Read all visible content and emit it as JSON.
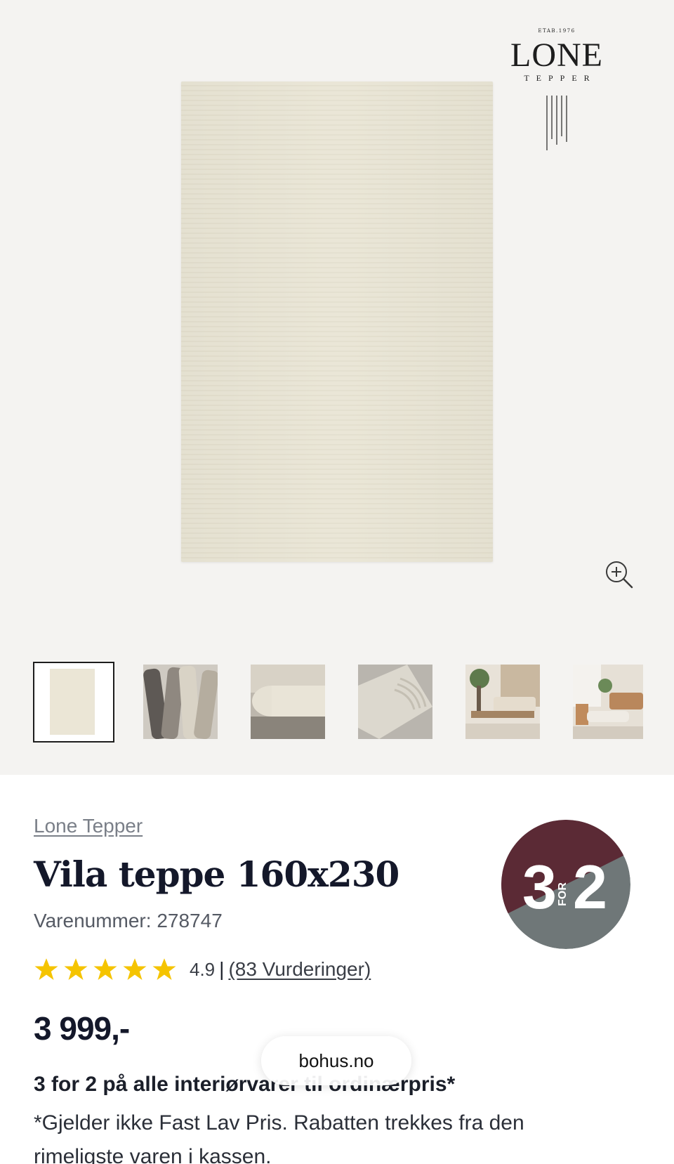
{
  "gallery": {
    "main_image_alt": "Vila teppe",
    "brand_logo": {
      "etab": "ETAB.1976",
      "name": "LONE",
      "sub": "TEPPER"
    },
    "zoom_icon": "zoom-in-icon",
    "thumbnails": [
      {
        "label": "thumbnail-1",
        "active": true
      },
      {
        "label": "thumbnail-2",
        "active": false
      },
      {
        "label": "thumbnail-3",
        "active": false
      },
      {
        "label": "thumbnail-4",
        "active": false
      },
      {
        "label": "thumbnail-5",
        "active": false
      },
      {
        "label": "thumbnail-6",
        "active": false
      }
    ]
  },
  "product": {
    "brand": "Lone Tepper",
    "title": "Vila teppe 160x230",
    "sku_label": "Varenummer:",
    "sku": "278747",
    "rating": {
      "stars": 5,
      "value": "4.9",
      "separator": "|",
      "count_label": "(83 Vurderinger)"
    },
    "price": "3 999,-",
    "badge": {
      "left": "3",
      "middle": "FOR",
      "right": "2",
      "top_color": "#5b2a35",
      "bottom_color": "#6f7778"
    },
    "promo_title": "3 for 2 på alle interiørvarer til ordinærpris*",
    "promo_text": "*Gjelder ikke Fast Lav Pris. Rabatten trekkes fra den rimeligste varen i kassen."
  },
  "browser": {
    "url": "bohus.no"
  },
  "colors": {
    "star": "#f5c400",
    "text_dark": "#14182a",
    "gallery_bg": "#f4f3f1"
  }
}
